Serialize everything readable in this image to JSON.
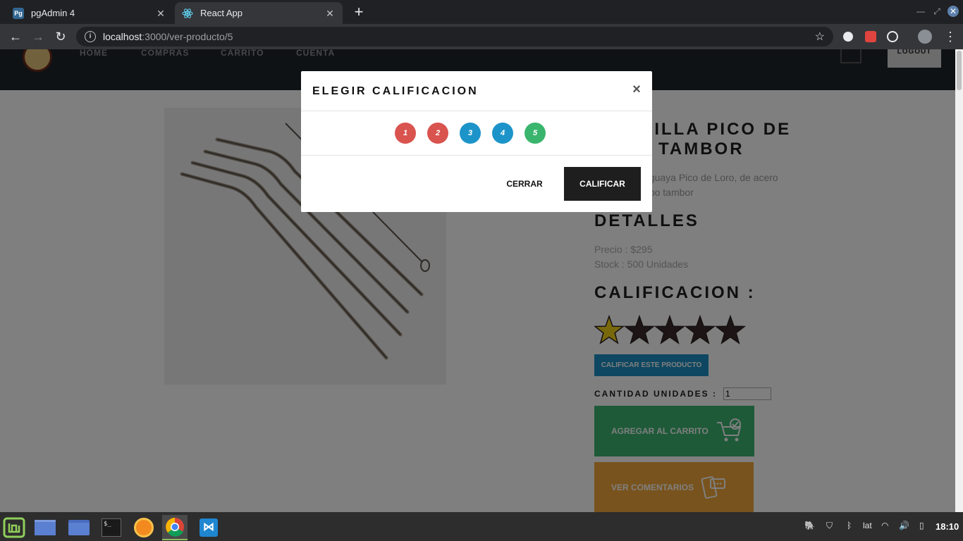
{
  "browser": {
    "tabs": [
      {
        "title": "pgAdmin 4",
        "favicon": "pgadmin-icon"
      },
      {
        "title": "React App",
        "favicon": "react-icon"
      }
    ],
    "url_host": "localhost",
    "url_path": ":3000/ver-producto/5"
  },
  "nav": {
    "links": [
      "HOME",
      "COMPRAS",
      "CARRITO",
      "CUENTA"
    ],
    "logout": "LOGOUT"
  },
  "product": {
    "title": "BOMBILLA PICO DE LORO TAMBOR",
    "description": "Bombilla uruguaya Pico de Loro, de acero inoxidable, tipo tambor",
    "details_heading": "DETALLES",
    "price": "Precio : $295",
    "stock": "Stock : 500 Unidades",
    "rating_heading": "CALIFICACION :",
    "rating": 1,
    "rating_max": 5,
    "rate_button": "CALIFICAR ESTE PRODUCTO",
    "qty_label": "CANTIDAD UNIDADES :",
    "qty_value": "1",
    "add_to_cart": "AGREGAR AL CARRITO",
    "view_comments": "VER COMENTARIOS"
  },
  "modal": {
    "title": "ELEGIR CALIFICACION",
    "close_symbol": "×",
    "options": [
      {
        "label": "1",
        "color": "#d9534f"
      },
      {
        "label": "2",
        "color": "#d9534f"
      },
      {
        "label": "3",
        "color": "#1d94c9"
      },
      {
        "label": "4",
        "color": "#1d94c9"
      },
      {
        "label": "5",
        "color": "#3ab56d"
      }
    ],
    "cancel": "CERRAR",
    "confirm": "CALIFICAR"
  },
  "taskbar": {
    "apps": [
      "mint-menu-icon",
      "desktop-icon",
      "files-icon",
      "terminal-icon",
      "firefox-icon",
      "chrome-icon",
      "vscode-icon"
    ],
    "layout": "lat",
    "clock": "18:10"
  },
  "colors": {
    "navbar": "#1e252a",
    "accent_blue": "#1d8fc2",
    "green": "#3db571",
    "orange": "#f3a73b",
    "star_filled": "#f2d21a",
    "star_empty": "#3a2a2a"
  }
}
